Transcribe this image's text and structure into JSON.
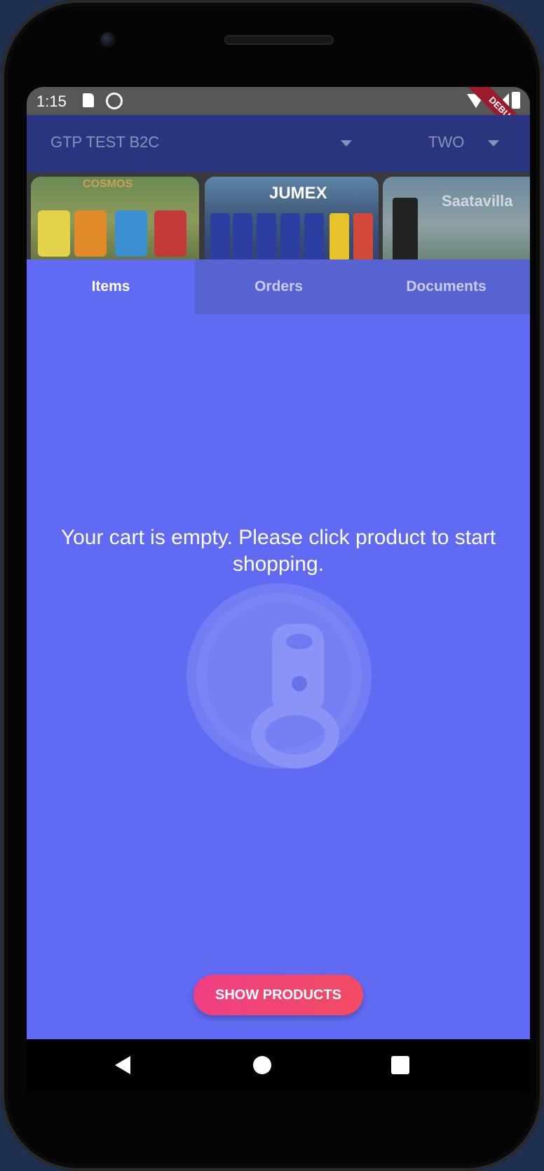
{
  "status_bar": {
    "time": "1:15",
    "debug_label": "DEBUG"
  },
  "appbar": {
    "company": "GTP TEST B2C",
    "branch": "TWO"
  },
  "banners": [
    {
      "title": "COSMOS",
      "alt": "Cosmos chips: Sea Salt, Cheddar, Coconut, Salted Caramel"
    },
    {
      "title": "JUMEX",
      "alt": "Jumex juice cans"
    },
    {
      "title": "Saatavilla",
      "alt": "Jumex stand promo"
    }
  ],
  "tabs": [
    {
      "label": "Items",
      "active": true
    },
    {
      "label": "Orders",
      "active": false
    },
    {
      "label": "Documents",
      "active": false
    }
  ],
  "empty_state": {
    "message": "Your cart is empty. Please click product to start shopping.",
    "button_label": "SHOW PRODUCTS",
    "icon": "can-lid-icon"
  },
  "colors": {
    "appbar": "#2a3580",
    "content": "#616af2",
    "button": "#f24b63"
  }
}
